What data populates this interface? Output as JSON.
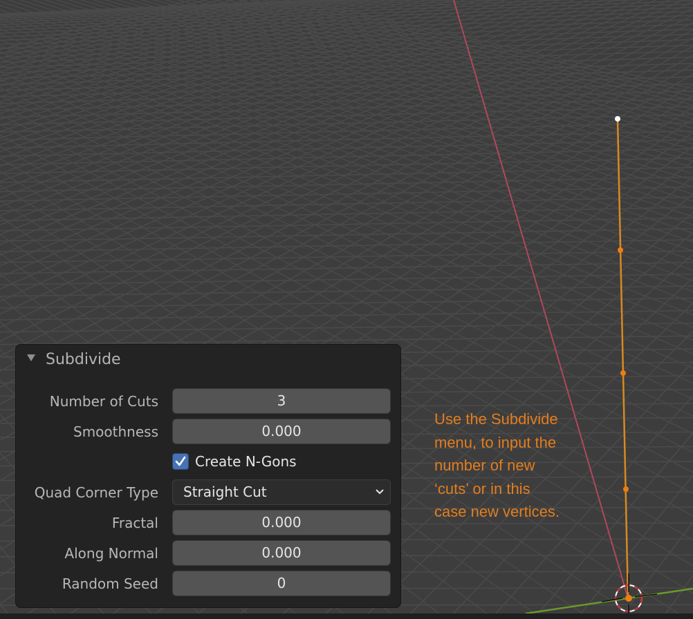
{
  "panel": {
    "title": "Subdivide",
    "collapse_icon": "triangle-down-icon",
    "fields": [
      {
        "label": "Number of Cuts",
        "type": "number",
        "value": "3"
      },
      {
        "label": "Smoothness",
        "type": "number",
        "value": "0.000"
      },
      {
        "label": "Create N-Gons",
        "type": "checkbox",
        "checked": true
      },
      {
        "label": "Quad Corner Type",
        "type": "dropdown",
        "value": "Straight Cut",
        "icon": "chevron-down-icon"
      },
      {
        "label": "Fractal",
        "type": "number",
        "value": "0.000"
      },
      {
        "label": "Along Normal",
        "type": "number",
        "value": "0.000"
      },
      {
        "label": "Random Seed",
        "type": "number",
        "value": "0"
      }
    ]
  },
  "annotation": {
    "lines": [
      "Use the Subdivide",
      "menu, to input the",
      "number of new",
      "‘cuts’ or in this",
      "case new vertices."
    ],
    "color": "#e37d1f"
  },
  "viewport": {
    "background": "#3d3d3d",
    "grid_color": "#4a4a4a",
    "x_axis_color": "#b0485a",
    "y_axis_color": "#6a9a2a",
    "edge_color": "#d98a1e",
    "selected_vertex_color": "#ffffff",
    "vertex_color": "#f07d10",
    "vertex_count": 5,
    "selected_vertices": 1,
    "cursor_icon": "3d-cursor-icon"
  }
}
